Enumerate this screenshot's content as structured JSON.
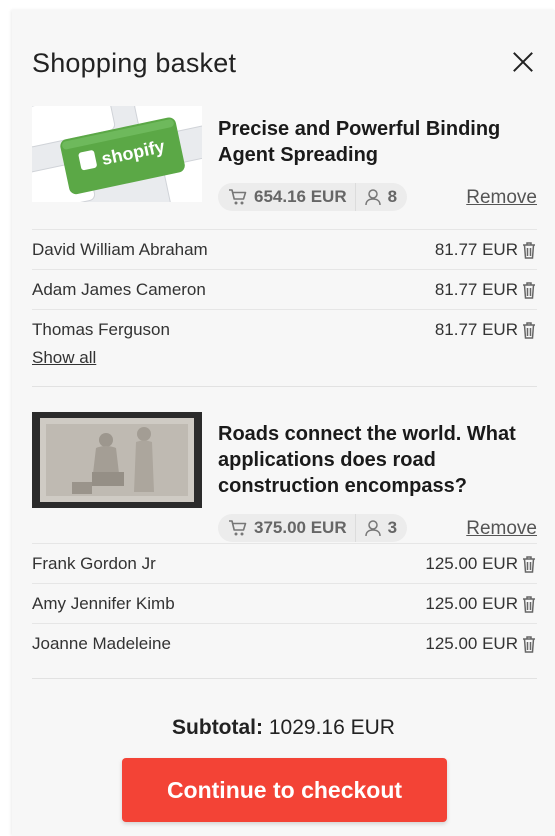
{
  "basket": {
    "title": "Shopping basket",
    "items": [
      {
        "title": "Precise and Powerful Binding Agent Spreading",
        "image_label": "shopify",
        "total": "654.16 EUR",
        "participants": "8",
        "remove_label": "Remove",
        "rows": [
          {
            "name": "David William Abraham",
            "price": "81.77 EUR"
          },
          {
            "name": "Adam James Cameron",
            "price": "81.77 EUR"
          },
          {
            "name": "Thomas Ferguson",
            "price": "81.77 EUR"
          }
        ],
        "show_all_label": "Show all"
      },
      {
        "title": "Roads connect the world. What applications does road construction encompass?",
        "total": "375.00 EUR",
        "participants": "3",
        "remove_label": "Remove",
        "rows": [
          {
            "name": "Frank Gordon Jr",
            "price": "125.00 EUR"
          },
          {
            "name": "Amy Jennifer Kimb",
            "price": "125.00 EUR"
          },
          {
            "name": "Joanne Madeleine",
            "price": "125.00 EUR"
          }
        ]
      }
    ],
    "subtotal_label": "Subtotal:",
    "subtotal_value": "1029.16 EUR",
    "checkout_label": "Continue to checkout"
  },
  "icons": [
    "close-icon",
    "cart-icon",
    "person-icon",
    "trash-icon"
  ],
  "colors": {
    "accent": "#f34336",
    "panel_bg": "#f7f7f7",
    "chip_bg": "#ececec",
    "shopify_green": "#5ba846"
  }
}
